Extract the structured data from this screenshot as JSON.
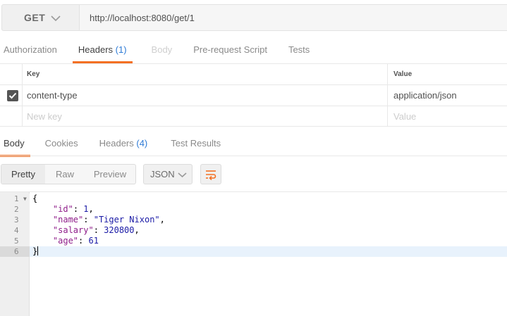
{
  "request": {
    "method": "GET",
    "url": "http://localhost:8080/get/1"
  },
  "request_tabs": [
    {
      "label": "Authorization",
      "count": "",
      "state": "normal"
    },
    {
      "label": "Headers",
      "count": "(1)",
      "state": "active"
    },
    {
      "label": "Body",
      "count": "",
      "state": "disabled"
    },
    {
      "label": "Pre-request Script",
      "count": "",
      "state": "normal"
    },
    {
      "label": "Tests",
      "count": "",
      "state": "normal"
    }
  ],
  "headers_table": {
    "columns": [
      "Key",
      "Value"
    ],
    "rows": [
      {
        "checked": true,
        "key": "content-type",
        "value": "application/json"
      }
    ],
    "new_row": {
      "key_placeholder": "New key",
      "value_placeholder": "Value"
    }
  },
  "response_tabs": [
    {
      "label": "Body",
      "count": "",
      "state": "active"
    },
    {
      "label": "Cookies",
      "count": "",
      "state": "normal"
    },
    {
      "label": "Headers",
      "count": "(4)",
      "state": "normal"
    },
    {
      "label": "Test Results",
      "count": "",
      "state": "normal"
    }
  ],
  "response_toolbar": {
    "views": [
      "Pretty",
      "Raw",
      "Preview"
    ],
    "active_view": "Pretty",
    "format": "JSON",
    "wrap_icon": "wrap-lines-icon"
  },
  "response_body": {
    "lines": [
      {
        "n": "1",
        "text": "{"
      },
      {
        "n": "2",
        "text": "    \"id\": 1,"
      },
      {
        "n": "3",
        "text": "    \"name\": \"Tiger Nixon\","
      },
      {
        "n": "4",
        "text": "    \"salary\": 320800,"
      },
      {
        "n": "5",
        "text": "    \"age\": 61"
      },
      {
        "n": "6",
        "text": "}"
      }
    ],
    "current_line": 6
  },
  "colors": {
    "accent": "#f47023",
    "count_blue": "#2e7bd6",
    "json_key": "#8f1e8a",
    "json_value": "#1a1aa6"
  }
}
